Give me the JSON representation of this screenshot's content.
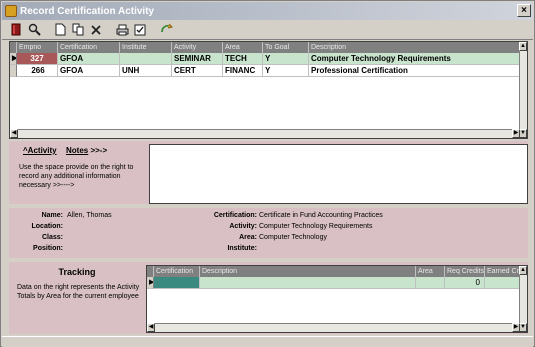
{
  "window": {
    "title": "Record Certification Activity",
    "close_label": "×"
  },
  "toolbar": [
    "close-book-icon",
    "zoom-icon",
    "new-doc-icon",
    "copy-doc-icon",
    "delete-icon",
    "print-icon",
    "checklist-icon",
    "refresh-icon"
  ],
  "grid": {
    "columns": [
      "Empno",
      "Certification",
      "Institute",
      "Activity",
      "Area",
      "To Goal",
      "Description"
    ],
    "rows": [
      {
        "empno": "327",
        "certification": "GFOA",
        "institute": "",
        "activity": "SEMINAR",
        "area": "TECH",
        "to_goal": "Y",
        "description": "Computer Technology Requirements",
        "selected": true
      },
      {
        "empno": "266",
        "certification": "GFOA",
        "institute": "UNH",
        "activity": "CERT",
        "area": "FINANC",
        "to_goal": "Y",
        "description": "Professional Certification",
        "selected": false
      }
    ]
  },
  "activity_panel": {
    "activity_tab": "^Activity",
    "notes_tab_u": "Notes",
    "notes_tab_arrow": " >>->",
    "help": "Use the space provide on the right to record any additional information necessary >>---->"
  },
  "info": {
    "name_label": "Name:",
    "name": "Allen, Thomas",
    "location_label": "Location:",
    "location": "",
    "class_label": "Class:",
    "class": "",
    "position_label": "Position:",
    "position": "",
    "certification_label": "Certification:",
    "certification": "Certificate in Fund Accounting Practices",
    "activity_label": "Activity:",
    "activity": "Computer Technology Requirements",
    "area_label": "Area:",
    "area": "Computer Technology",
    "institute_label": "Institute:",
    "institute": ""
  },
  "tracking": {
    "title": "Tracking",
    "help": "Data on the right represents the Activity Totals by Area for the current employee",
    "columns": [
      "Certification",
      "Description",
      "Area",
      "Req Credits",
      "Earned Cr"
    ],
    "row": {
      "certification": "",
      "description": "",
      "area": "",
      "req_credits": "0",
      "earned": ""
    }
  },
  "colors": {
    "accent": "#a85858",
    "selected_row": "#c8e4cc",
    "panel": "#d8c0c4",
    "header": "#808080"
  }
}
